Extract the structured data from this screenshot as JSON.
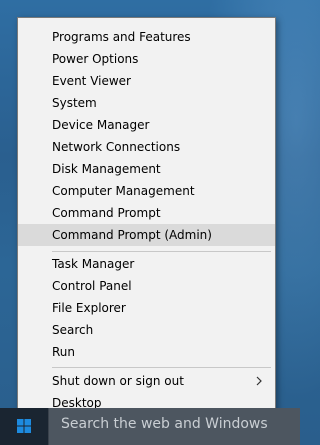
{
  "menu": {
    "group1": [
      {
        "label": "Programs and Features"
      },
      {
        "label": "Power Options"
      },
      {
        "label": "Event Viewer"
      },
      {
        "label": "System"
      },
      {
        "label": "Device Manager"
      },
      {
        "label": "Network Connections"
      },
      {
        "label": "Disk Management"
      },
      {
        "label": "Computer Management"
      },
      {
        "label": "Command Prompt"
      },
      {
        "label": "Command Prompt (Admin)",
        "highlighted": true
      }
    ],
    "group2": [
      {
        "label": "Task Manager"
      },
      {
        "label": "Control Panel"
      },
      {
        "label": "File Explorer"
      },
      {
        "label": "Search"
      },
      {
        "label": "Run"
      }
    ],
    "group3": [
      {
        "label": "Shut down or sign out",
        "has_submenu": true,
        "icon": "chevron-right-icon"
      },
      {
        "label": "Desktop"
      }
    ]
  },
  "taskbar": {
    "start_icon": "windows-logo-icon",
    "search_placeholder": "Search the web and Windows"
  },
  "colors": {
    "menu_background": "#f2f2f2",
    "highlight": "#dadada",
    "taskbar": "#1a2531",
    "search_box": "#4d5660",
    "windows_logo": "#1d8be0"
  }
}
